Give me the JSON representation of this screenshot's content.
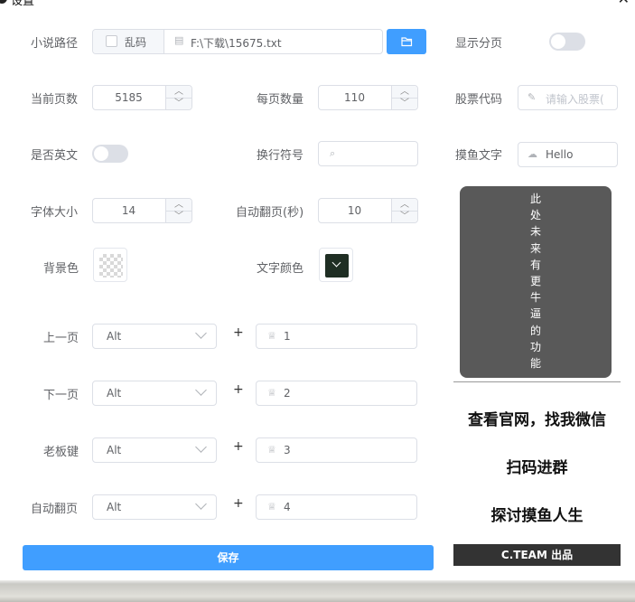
{
  "window": {
    "title": "设置",
    "close_icon": "close-icon"
  },
  "novel_path": {
    "label": "小说路径",
    "garbled_label": "乱码",
    "path_value": "F:\\下载\\15675.txt",
    "folder_icon": "folder-open-icon"
  },
  "show_paging": {
    "label": "显示分页",
    "on": false
  },
  "current_page": {
    "label": "当前页数",
    "value": "5185"
  },
  "page_count": {
    "label": "每页数量",
    "value": "110"
  },
  "stock_code": {
    "label": "股票代码",
    "placeholder": "请输入股票("
  },
  "english": {
    "label": "是否英文",
    "on": false
  },
  "newline_symbol": {
    "label": "换行符号",
    "value": ""
  },
  "fish_text": {
    "label": "摸鱼文字",
    "value": "Hello"
  },
  "font_size": {
    "label": "字体大小",
    "value": "14"
  },
  "auto_flip": {
    "label": "自动翻页(秒)",
    "value": "10"
  },
  "background_color": {
    "label": "背景色",
    "color": "transparent"
  },
  "text_color": {
    "label": "文字颜色",
    "color": "#1f2e23"
  },
  "hotkeys": [
    {
      "label": "上一页",
      "modifier": "Alt",
      "key": "1"
    },
    {
      "label": "下一页",
      "modifier": "Alt",
      "key": "2"
    },
    {
      "label": "老板键",
      "modifier": "Alt",
      "key": "3"
    },
    {
      "label": "自动翻页",
      "modifier": "Alt",
      "key": "4"
    }
  ],
  "plus_sign": "+",
  "save_label": "保存",
  "feature_panel": {
    "text": "此处未来有更牛逼的功能"
  },
  "promo": {
    "line1": "查看官网，找我微信",
    "line2": "扫码进群",
    "line3": "探讨摸鱼人生"
  },
  "footer": "C.TEAM 出品"
}
